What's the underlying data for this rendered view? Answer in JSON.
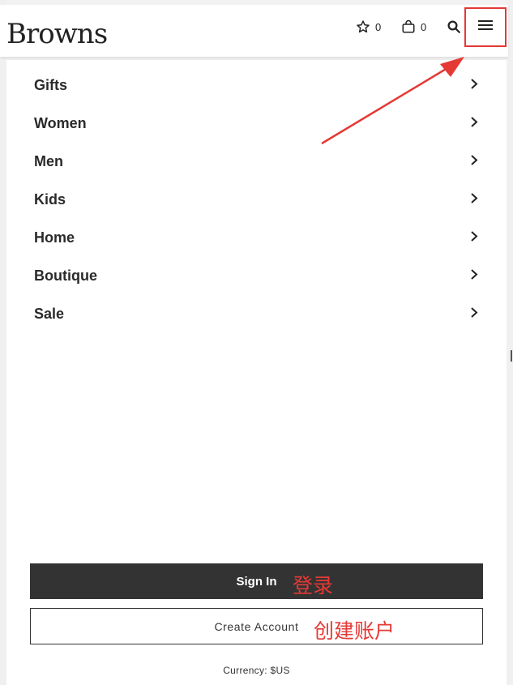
{
  "header": {
    "logo_text": "Browns",
    "wishlist": {
      "icon": "star-outline-icon",
      "count": "0"
    },
    "bag": {
      "icon": "shopping-bag-icon",
      "count": "0"
    },
    "search": {
      "icon": "search-icon"
    },
    "menu": {
      "icon": "hamburger-menu-icon"
    }
  },
  "nav": {
    "items": [
      {
        "label": "Gifts"
      },
      {
        "label": "Women"
      },
      {
        "label": "Men"
      },
      {
        "label": "Kids"
      },
      {
        "label": "Home"
      },
      {
        "label": "Boutique"
      },
      {
        "label": "Sale"
      }
    ],
    "chevron_icon": "chevron-right-icon"
  },
  "account": {
    "sign_in_label": "Sign In",
    "create_account_label": "Create Account",
    "currency_text": "Currency: $US"
  },
  "annotations": {
    "sign_in_note": "登录",
    "create_account_note": "创建账户",
    "color": "#e53935"
  },
  "colors": {
    "accent_dark": "#333333",
    "highlight_red": "#e53935"
  }
}
